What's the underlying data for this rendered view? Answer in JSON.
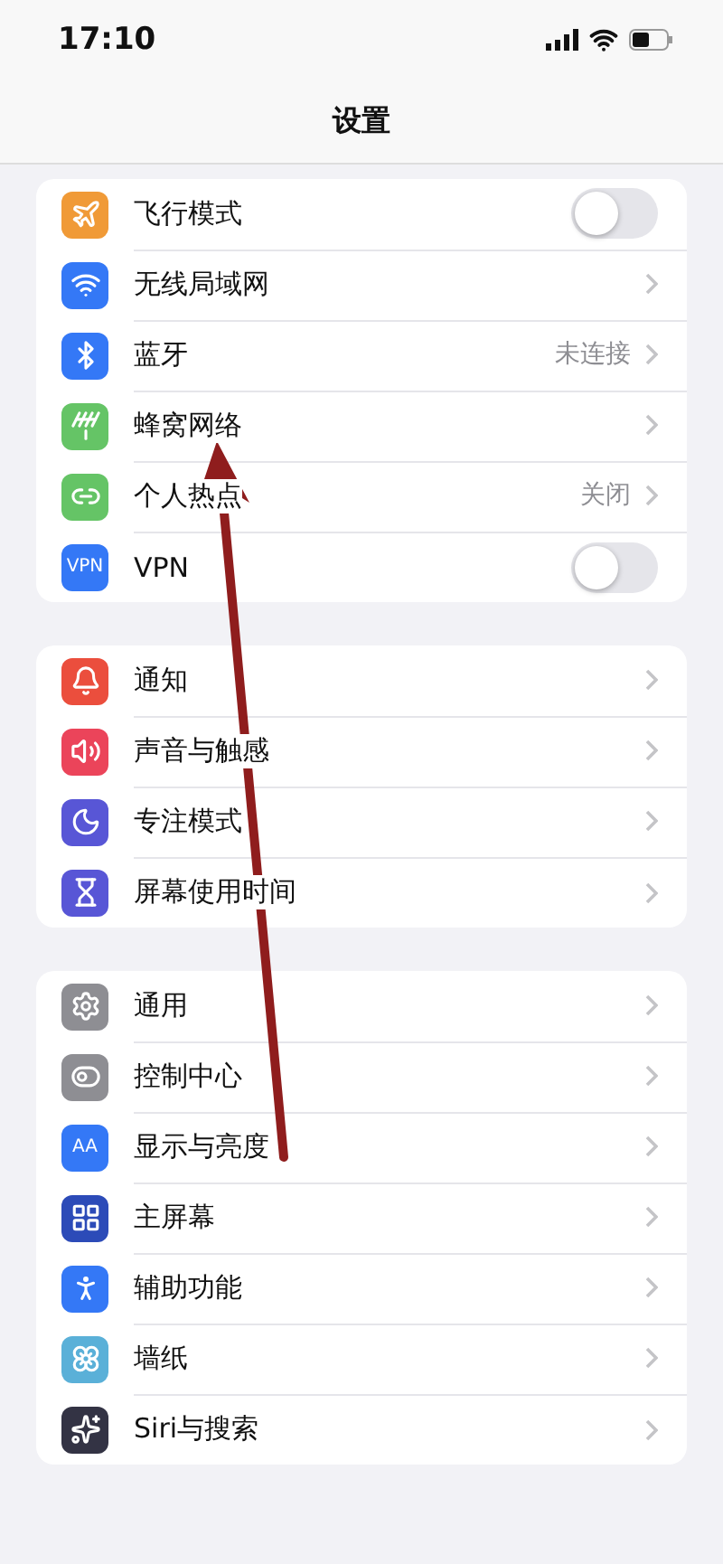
{
  "status_bar": {
    "time": "17:10"
  },
  "title": "设置",
  "groups": [
    {
      "items": [
        {
          "label": "飞行模式",
          "kind": "toggle",
          "on": false,
          "color": "#f09a37"
        },
        {
          "label": "无线局域网",
          "kind": "link",
          "color": "#3478f6"
        },
        {
          "label": "蓝牙",
          "kind": "link",
          "value": "未连接",
          "color": "#3478f6"
        },
        {
          "label": "蜂窝网络",
          "kind": "link",
          "color": "#65c466"
        },
        {
          "label": "个人热点",
          "kind": "link",
          "value": "关闭",
          "color": "#65c466"
        },
        {
          "label": "VPN",
          "kind": "toggle",
          "on": false,
          "color": "#3478f6",
          "icon_text": "VPN"
        }
      ]
    },
    {
      "items": [
        {
          "label": "通知",
          "kind": "link",
          "color": "#eb4e3d"
        },
        {
          "label": "声音与触感",
          "kind": "link",
          "color": "#eb445a"
        },
        {
          "label": "专注模式",
          "kind": "link",
          "color": "#5856d6"
        },
        {
          "label": "屏幕使用时间",
          "kind": "link",
          "color": "#5856d6"
        }
      ]
    },
    {
      "items": [
        {
          "label": "通用",
          "kind": "link",
          "color": "#8e8e93"
        },
        {
          "label": "控制中心",
          "kind": "link",
          "color": "#8e8e93"
        },
        {
          "label": "显示与亮度",
          "kind": "link",
          "color": "#3478f6",
          "icon_text": "AA"
        },
        {
          "label": "主屏幕",
          "kind": "link",
          "color": "#2c4bb8"
        },
        {
          "label": "辅助功能",
          "kind": "link",
          "color": "#3478f6"
        },
        {
          "label": "墙纸",
          "kind": "link",
          "color": "#5ab0d8"
        },
        {
          "label": "Siri与搜索",
          "kind": "link",
          "color": "#333344"
        }
      ]
    }
  ]
}
